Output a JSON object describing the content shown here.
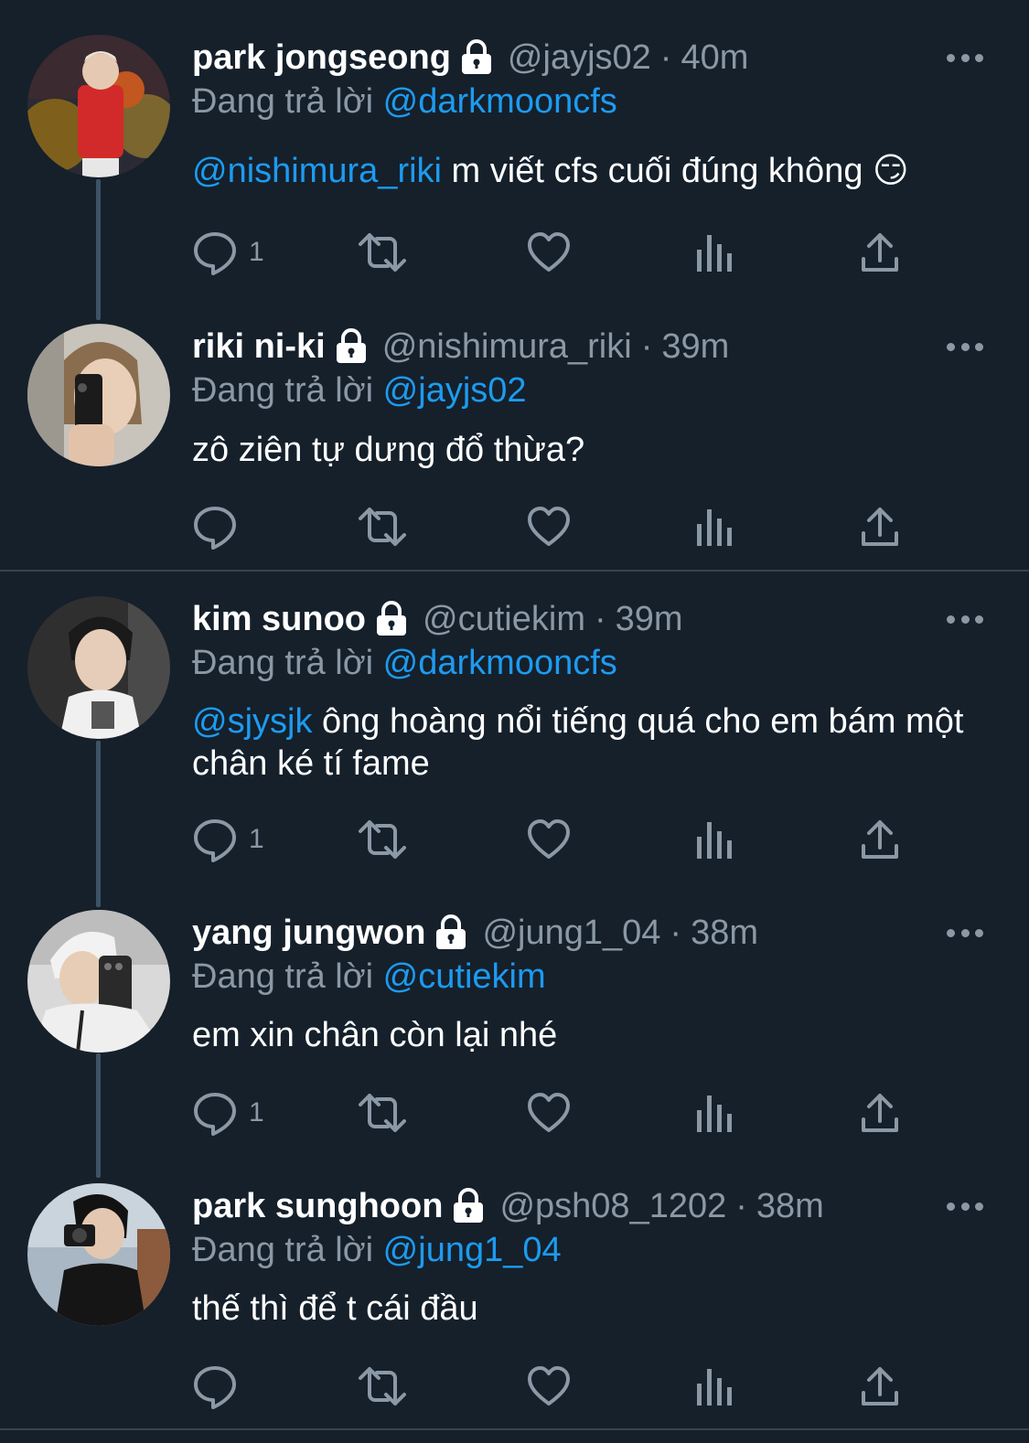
{
  "colors": {
    "background": "#15202b",
    "text_primary": "#ffffff",
    "text_secondary": "#8b98a5",
    "accent_link": "#1d9bf0",
    "divider": "#38444d",
    "thread_line": "#3d5466"
  },
  "labels": {
    "replying_to": "Đang trả lời",
    "dot": "·"
  },
  "icons": {
    "lock": "lock-icon",
    "more": "more-options-icon",
    "reply": "reply-icon",
    "retweet": "retweet-icon",
    "like": "like-heart-icon",
    "views": "views-chart-icon",
    "share": "share-icon"
  },
  "tweets": [
    {
      "name": "park jongseong",
      "handle": "@jayjs02",
      "time": "40m",
      "replying_to": "@darkmooncfs",
      "mention": "@nishimura_riki",
      "text": "m viết cfs cuối đúng không 😏",
      "reply_count": "1"
    },
    {
      "name": "riki ni-ki",
      "handle": "@nishimura_riki",
      "time": "39m",
      "replying_to": "@jayjs02",
      "mention": "",
      "text": "zô ziên tự dưng đổ thừa?",
      "reply_count": ""
    },
    {
      "name": "kim sunoo",
      "handle": "@cutiekim",
      "time": "39m",
      "replying_to": "@darkmooncfs",
      "mention": "@sjysjk",
      "text": "ông hoàng nổi tiếng quá cho em bám một chân ké tí fame",
      "reply_count": "1"
    },
    {
      "name": "yang jungwon",
      "handle": "@jung1_04",
      "time": "38m",
      "replying_to": "@cutiekim",
      "mention": "",
      "text": "em xin chân còn lại nhé",
      "reply_count": "1"
    },
    {
      "name": "park sunghoon",
      "handle": "@psh08_1202",
      "time": "38m",
      "replying_to": "@jung1_04",
      "mention": "",
      "text": "thế thì để t cái đầu",
      "reply_count": ""
    }
  ]
}
